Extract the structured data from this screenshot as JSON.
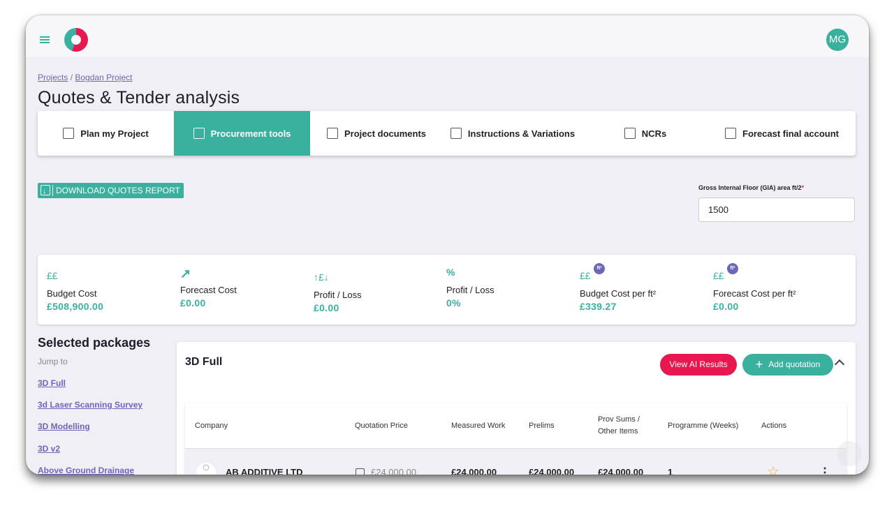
{
  "topbar": {
    "avatar_initials": "MG"
  },
  "breadcrumb": {
    "projects": "Projects",
    "separator": "/",
    "project": "Bogdan Project"
  },
  "page": {
    "title": "Quotes & Tender analysis"
  },
  "tabs": [
    {
      "label": "Plan my Project",
      "icon": "megaphone-icon"
    },
    {
      "label": "Procurement tools",
      "icon": "chart-icon",
      "active": true
    },
    {
      "label": "Project documents",
      "icon": "documents-icon"
    },
    {
      "label": "Instructions & Variations",
      "icon": "book-icon"
    },
    {
      "label": "NCRs",
      "icon": "grid-icon"
    },
    {
      "label": "Forecast final account",
      "icon": "ledger-icon"
    }
  ],
  "download": {
    "label": "DOWNLOAD QUOTES REPORT"
  },
  "gia": {
    "label": "Gross Internal Floor (GIA) area ft/2",
    "required_mark": "*",
    "value": "1500"
  },
  "stats": [
    {
      "icon_text": "££",
      "label": "Budget Cost",
      "value": "£508,900.00"
    },
    {
      "icon_text": "↗",
      "label": "Forecast Cost",
      "value": "£0.00"
    },
    {
      "icon_text": "↑£↓",
      "label": "Profit / Loss",
      "value": "£0.00"
    },
    {
      "icon_text": "%",
      "label": "Profit / Loss",
      "value": "0%"
    },
    {
      "icon_text": "££",
      "badge": "ft²",
      "label": "Budget Cost per ft²",
      "value": "£339.27"
    },
    {
      "icon_text": "££",
      "badge": "ft²",
      "label": "Forecast Cost per ft²",
      "value": "£0.00"
    }
  ],
  "packages": {
    "title": "Selected packages",
    "jump_to": "Jump to",
    "items": [
      "3D Full",
      "3d Laser Scanning Survey",
      "3D Modelling",
      "3D v2",
      "Above Ground Drainage"
    ]
  },
  "card": {
    "title": "3D Full",
    "ai_button": "View AI Results",
    "add_button": "Add quotation",
    "columns": [
      "Company",
      "Quotation Price",
      "Measured Work",
      "Prelims",
      "Prov Sums / Other Items",
      "Programme (Weeks)",
      "Actions"
    ],
    "row": {
      "company": "AB ADDITIVE LTD",
      "quotation_price": "£24,000.00",
      "measured_work": "£24,000.00",
      "prelims": "£24,000.00",
      "prov_sums": "£24,000.00",
      "programme": "1"
    }
  },
  "colors": {
    "accent": "#3ab09e",
    "danger": "#e8174f",
    "link": "#6b66b8"
  }
}
